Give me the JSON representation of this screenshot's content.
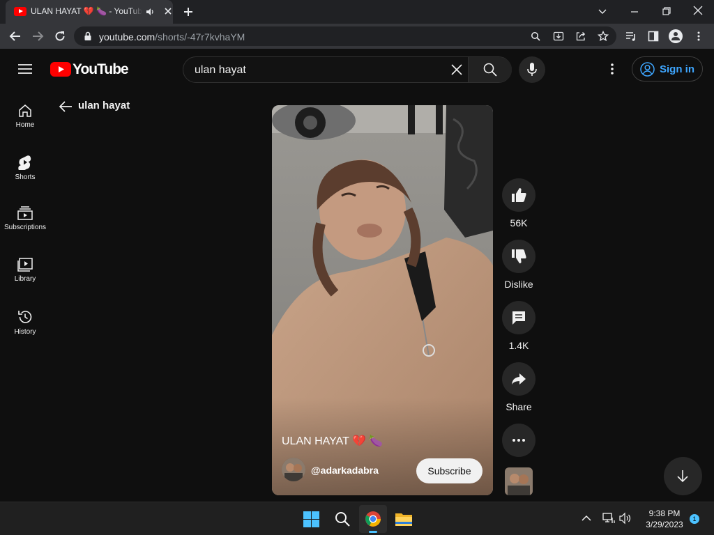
{
  "browser": {
    "tab_title": "ULAN HAYAT 💔 🍆 - YouTube",
    "url_domain": "youtube.com",
    "url_path": "/shorts/-47r7kvhaYM"
  },
  "youtube": {
    "logo_text": "YouTube",
    "search_query": "ulan hayat",
    "sign_in_label": "Sign in",
    "back_label": "ulan hayat",
    "sidebar": [
      {
        "label": "Home",
        "icon": "home-icon"
      },
      {
        "label": "Shorts",
        "icon": "shorts-icon"
      },
      {
        "label": "Subscriptions",
        "icon": "subscriptions-icon"
      },
      {
        "label": "Library",
        "icon": "library-icon"
      },
      {
        "label": "History",
        "icon": "history-icon"
      }
    ],
    "short": {
      "title": "ULAN HAYAT 💔 🍆",
      "channel": "@adarkadabra",
      "subscribe_label": "Subscribe"
    },
    "actions": {
      "like_count": "56K",
      "dislike_label": "Dislike",
      "comment_count": "1.4K",
      "share_label": "Share"
    }
  },
  "taskbar": {
    "time": "9:38 PM",
    "date": "3/29/2023",
    "notification_count": "1"
  },
  "colors": {
    "youtube_red": "#ff0000",
    "link_blue": "#3ea6ff",
    "background": "#0f0f0f"
  }
}
